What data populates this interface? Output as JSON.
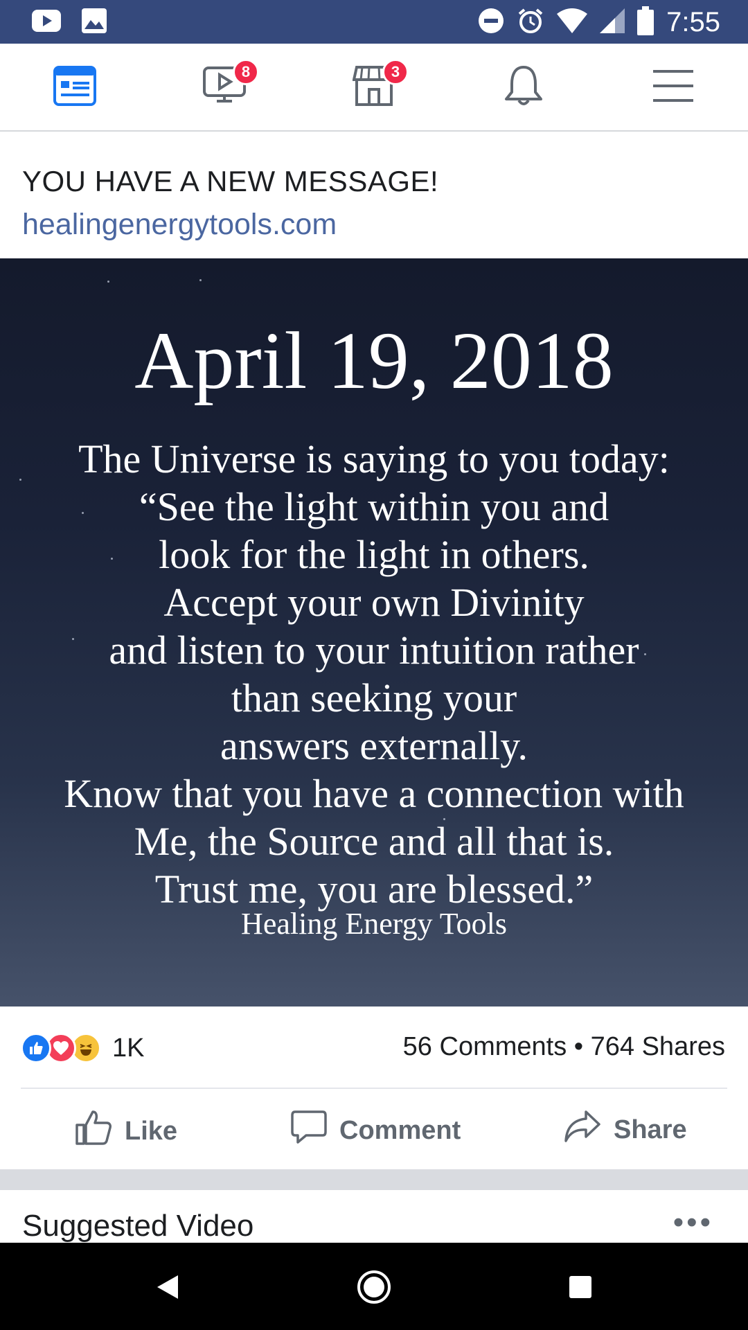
{
  "status_bar": {
    "time": "7:55",
    "left_icons": [
      "youtube-icon",
      "image-icon"
    ],
    "right_icons": [
      "do-not-disturb-icon",
      "alarm-icon",
      "wifi-icon",
      "signal-icon",
      "battery-icon"
    ],
    "color": "#35497c"
  },
  "top_nav": {
    "items": [
      {
        "name": "news-feed",
        "icon": "news-feed-icon",
        "badge": ""
      },
      {
        "name": "watch",
        "icon": "video-icon",
        "badge": "8"
      },
      {
        "name": "marketplace",
        "icon": "marketplace-icon",
        "badge": "3"
      },
      {
        "name": "notifications",
        "icon": "bell-icon",
        "badge": ""
      },
      {
        "name": "menu",
        "icon": "hamburger-menu-icon",
        "badge": ""
      }
    ],
    "active_color": "#1877f2"
  },
  "post": {
    "title": "YOU HAVE A NEW MESSAGE!",
    "link": "healingenergytools.com",
    "image": {
      "date": "April 19, 2018",
      "lines": [
        "The Universe is saying to you today:",
        "“See the light within you and",
        "look for the light in others.",
        "Accept your own Divinity",
        "and listen to your intuition rather",
        "than seeking your",
        "answers externally.",
        "Know that you have a connection with",
        "Me, the Source and all that is.",
        "Trust me, you are blessed.”"
      ],
      "source": "Healing Energy Tools"
    },
    "reactions": {
      "icons": [
        "like-reaction-icon",
        "love-reaction-icon",
        "haha-reaction-icon"
      ],
      "count": "1K"
    },
    "counts_text": "56 Comments • 764 Shares",
    "actions": {
      "like": "Like",
      "comment": "Comment",
      "share": "Share"
    }
  },
  "suggested": {
    "title": "Suggested Video",
    "more": "•••"
  },
  "android_nav": [
    "back-icon",
    "home-icon",
    "recents-icon"
  ]
}
